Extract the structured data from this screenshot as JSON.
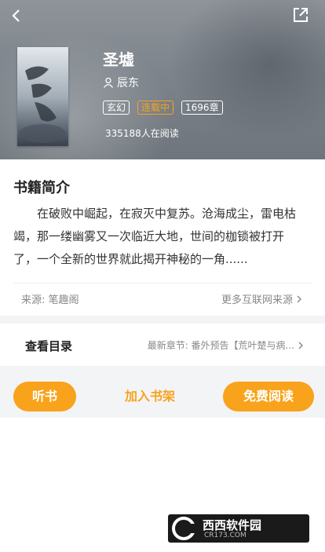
{
  "book": {
    "title": "圣墟",
    "author": "辰东",
    "tags": [
      "玄幻",
      "连载中",
      "1696章"
    ],
    "readers": "335188人在阅读"
  },
  "intro": {
    "heading": "书籍简介",
    "text": "在破败中崛起，在寂灭中复苏。沧海成尘，雷电枯竭，那一缕幽雾又一次临近大地，世间的枷锁被打开了，一个全新的世界就此揭开神秘的一角......"
  },
  "source": {
    "label": "来源: 笔趣阁",
    "more": "更多互联网来源"
  },
  "catalog": {
    "label": "查看目录",
    "latest": "最新章节: 番外预告【荒叶楚与病..."
  },
  "actions": {
    "listen": "听书",
    "add_shelf": "加入书架",
    "read_free": "免费阅读"
  },
  "watermark": {
    "text": "西西软件园",
    "url": "CR173.COM"
  },
  "colors": {
    "accent": "#f8a31b",
    "header_bg": "#7d848b"
  },
  "icons": [
    "back-arrow-icon",
    "share-icon",
    "user-icon",
    "chevron-right-icon"
  ]
}
